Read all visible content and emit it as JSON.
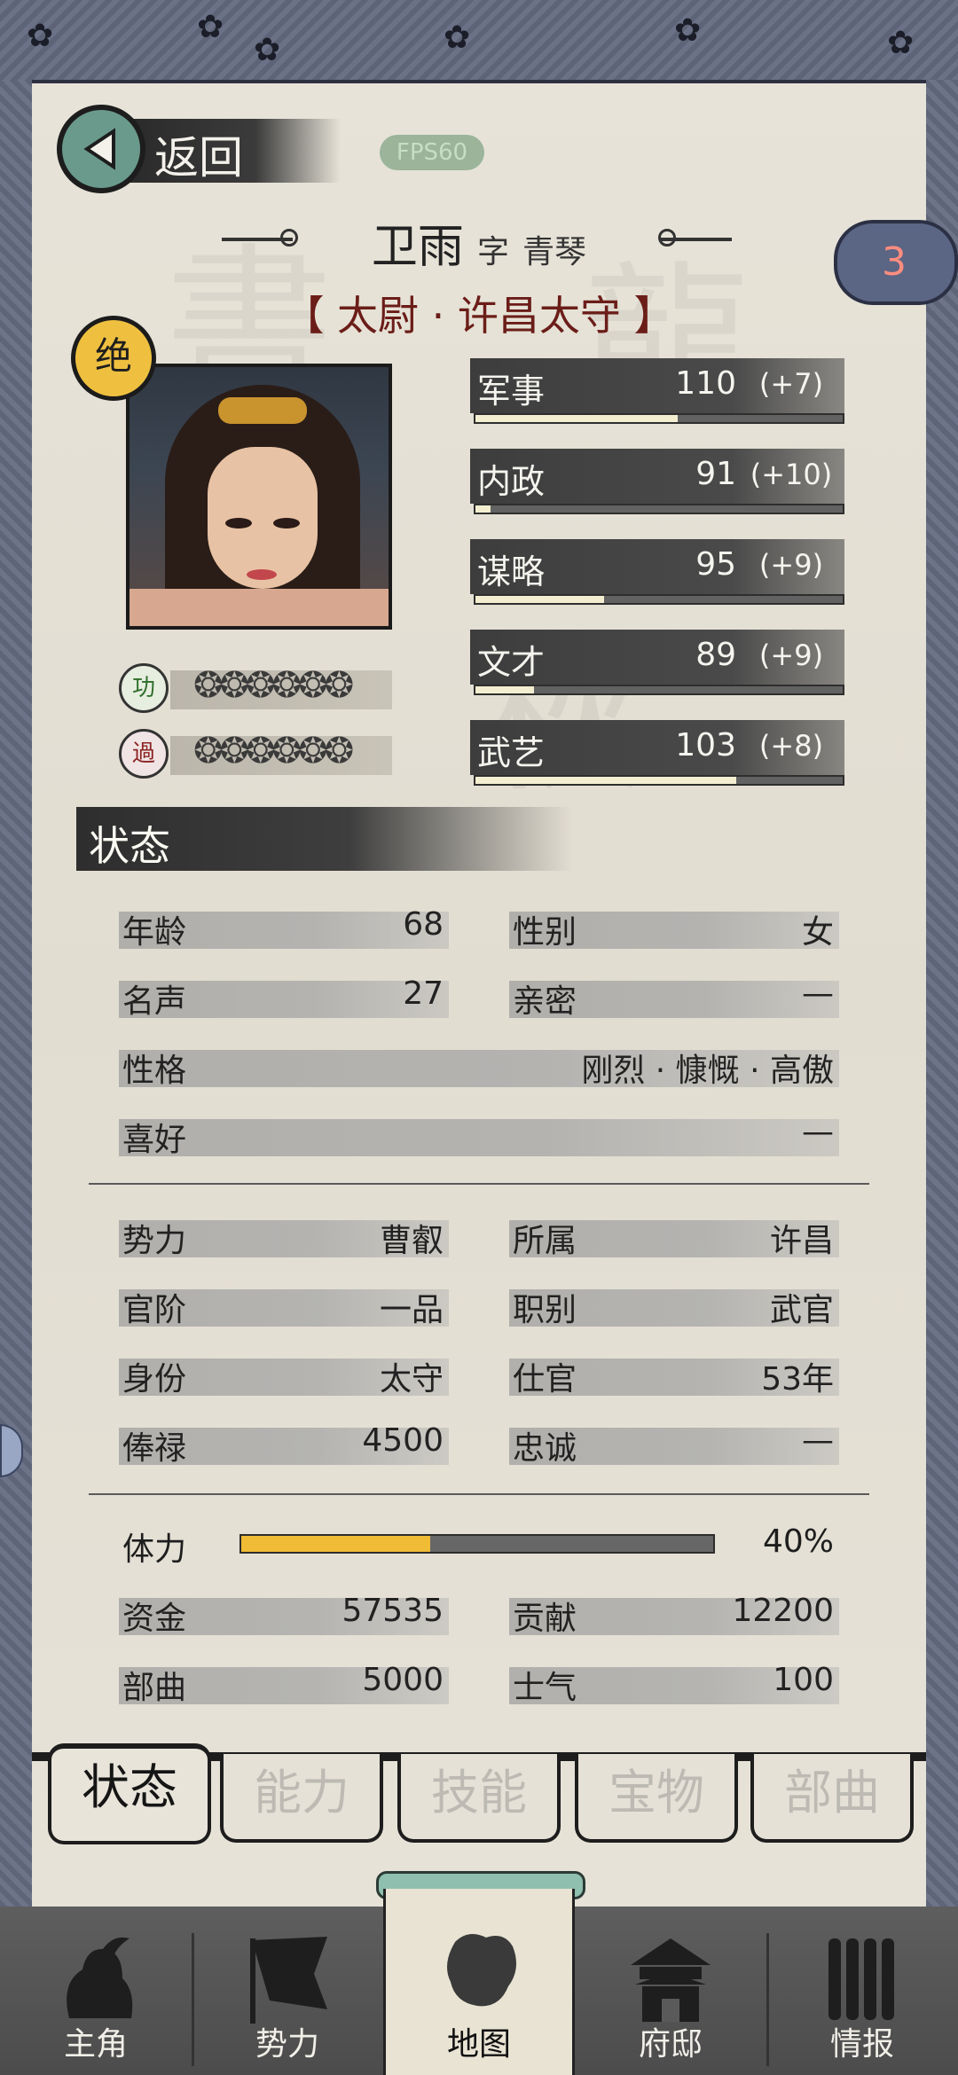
{
  "header": {
    "back_label": "返回",
    "fps": "FPS60"
  },
  "character": {
    "name": "卫雨",
    "courtesy_prefix": "字",
    "courtesy": "青琴",
    "title": "【 太尉 · 许昌太守 】",
    "badge": "绝",
    "cloud_count": "3",
    "merit_label": "功",
    "fault_label": "過"
  },
  "attributes": [
    {
      "label": "军事",
      "value": "110",
      "bonus": "(+7)",
      "fill": 0.55
    },
    {
      "label": "内政",
      "value": "91",
      "bonus": "(+10)",
      "fill": 0.04
    },
    {
      "label": "谋略",
      "value": "95",
      "bonus": "(+9)",
      "fill": 0.35
    },
    {
      "label": "文才",
      "value": "89",
      "bonus": "(+9)",
      "fill": 0.16
    },
    {
      "label": "武艺",
      "value": "103",
      "bonus": "(+8)",
      "fill": 0.71
    }
  ],
  "status": {
    "heading": "状态",
    "age_label": "年龄",
    "age": "68",
    "gender_label": "性别",
    "gender": "女",
    "fame_label": "名声",
    "fame": "27",
    "intimacy_label": "亲密",
    "intimacy": "—",
    "personality_label": "性格",
    "personality": "刚烈 · 慷慨 · 高傲",
    "hobby_label": "喜好",
    "hobby": "—",
    "faction_label": "势力",
    "faction": "曹叡",
    "belong_label": "所属",
    "belong": "许昌",
    "rank_label": "官阶",
    "rank": "一品",
    "post_label": "职别",
    "post": "武官",
    "identity_label": "身份",
    "identity": "太守",
    "service_label": "仕官",
    "service": "53年",
    "salary_label": "俸禄",
    "salary": "4500",
    "loyalty_label": "忠诚",
    "loyalty": "—",
    "stamina_label": "体力",
    "stamina": "40%",
    "stamina_fraction": 0.4,
    "funds_label": "资金",
    "funds": "57535",
    "contribution_label": "贡献",
    "contribution": "12200",
    "troops_label": "部曲",
    "troops": "5000",
    "morale_label": "士气",
    "morale": "100"
  },
  "tabs": [
    "状态",
    "能力",
    "技能",
    "宝物",
    "部曲"
  ],
  "nav": [
    "主角",
    "势力",
    "地图",
    "府邸",
    "情报"
  ]
}
